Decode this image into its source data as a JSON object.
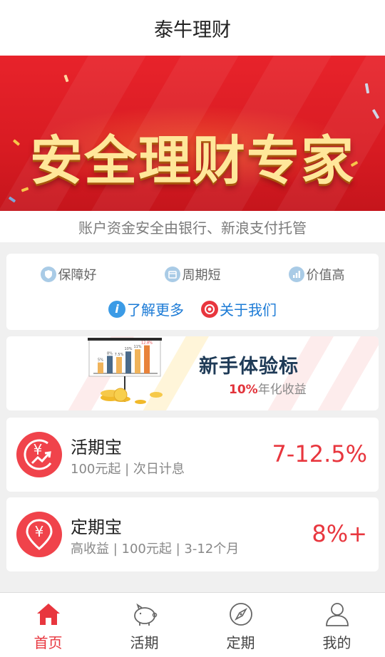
{
  "header": {
    "title": "泰牛理财"
  },
  "banner": {
    "headline": "安全理财专家"
  },
  "subtitle": "账户资金安全由银行、新浪支付托管",
  "features": [
    {
      "label": "保障好",
      "icon": "shield-icon"
    },
    {
      "label": "周期短",
      "icon": "calendar-icon"
    },
    {
      "label": "价值高",
      "icon": "chart-icon"
    }
  ],
  "links": [
    {
      "label": "了解更多",
      "icon": "info-icon",
      "color": "#3b9be6"
    },
    {
      "label": "关于我们",
      "icon": "target-icon",
      "color": "#e8363e"
    }
  ],
  "newbie": {
    "title": "新手体验标",
    "rate": "10%",
    "rate_suffix": "年化收益",
    "chart_labels": [
      "5%",
      "8%",
      "7.5%",
      "10%",
      "11%",
      "12.8%"
    ],
    "chart_values": [
      5,
      8,
      7.5,
      10,
      11,
      12.8
    ]
  },
  "products": [
    {
      "name": "活期宝",
      "meta": "100元起 | 次日计息",
      "rate": "7-12.5%",
      "icon": "yen-growth-icon"
    },
    {
      "name": "定期宝",
      "meta": "高收益 | 100元起 | 3-12个月",
      "rate": "8%+",
      "icon": "yen-pin-icon"
    }
  ],
  "tabs": [
    {
      "label": "首页",
      "icon": "home-icon",
      "active": true
    },
    {
      "label": "活期",
      "icon": "piggy-bank-icon",
      "active": false
    },
    {
      "label": "定期",
      "icon": "compass-icon",
      "active": false
    },
    {
      "label": "我的",
      "icon": "user-icon",
      "active": false
    }
  ],
  "colors": {
    "accent": "#e8363e",
    "link": "#1c7bd6",
    "navy": "#1f3b57"
  }
}
